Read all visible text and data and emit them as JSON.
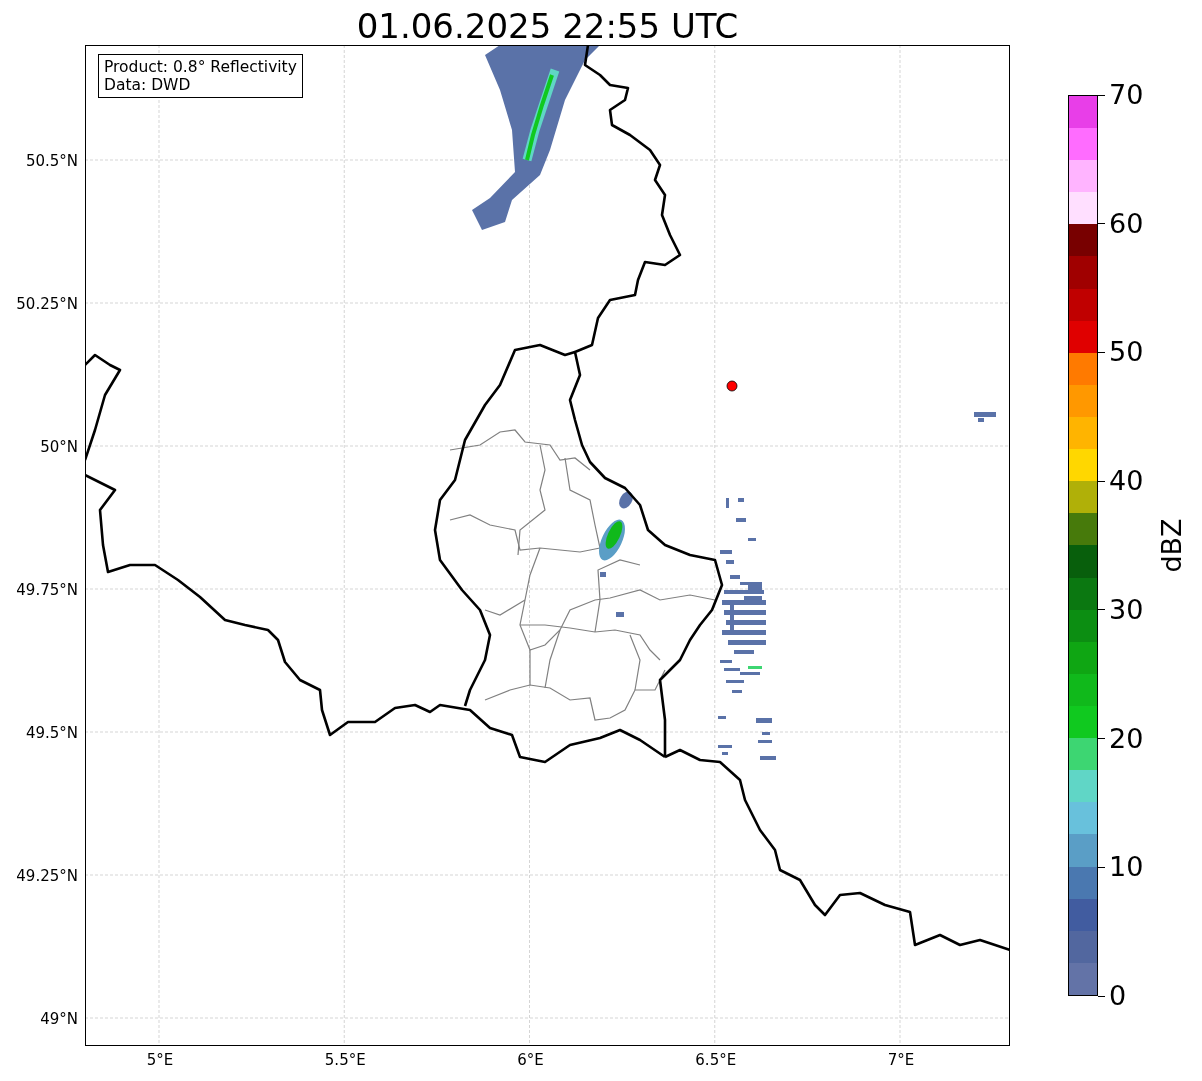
{
  "title": "01.06.2025 22:55 UTC",
  "info_box": {
    "lines": [
      "Product: 0.8° Reflectivity",
      "Data: DWD"
    ]
  },
  "map": {
    "lat_ticks": [
      "50.5°N",
      "50.25°N",
      "50°N",
      "49.75°N",
      "49.5°N",
      "49.25°N",
      "49°N"
    ],
    "lon_ticks": [
      "5°E",
      "5.5°E",
      "6°E",
      "6.5°E",
      "7°E"
    ]
  },
  "colorbar": {
    "label": "dBZ",
    "ticks": [
      "70",
      "60",
      "50",
      "40",
      "30",
      "20",
      "10",
      "0"
    ],
    "bins": [
      {
        "color": "#6373a7"
      },
      {
        "color": "#52679f"
      },
      {
        "color": "#415ca0"
      },
      {
        "color": "#4a78b0"
      },
      {
        "color": "#5a9ec6"
      },
      {
        "color": "#68c1dc"
      },
      {
        "color": "#60d6c6"
      },
      {
        "color": "#3dd672"
      },
      {
        "color": "#10c91f"
      },
      {
        "color": "#10b91b"
      },
      {
        "color": "#0fa613"
      },
      {
        "color": "#0c8e12"
      },
      {
        "color": "#0b7811"
      },
      {
        "color": "#085f0c"
      },
      {
        "color": "#477a0b"
      },
      {
        "color": "#b0b008"
      },
      {
        "color": "#ffd700"
      },
      {
        "color": "#ffb400"
      },
      {
        "color": "#ff9800"
      },
      {
        "color": "#ff7a00"
      },
      {
        "color": "#e00000"
      },
      {
        "color": "#c00000"
      },
      {
        "color": "#a00000"
      },
      {
        "color": "#780000"
      },
      {
        "color": "#ffdfff"
      },
      {
        "color": "#ffb4ff"
      },
      {
        "color": "#ff6cff"
      },
      {
        "color": "#e83ee8"
      }
    ]
  }
}
